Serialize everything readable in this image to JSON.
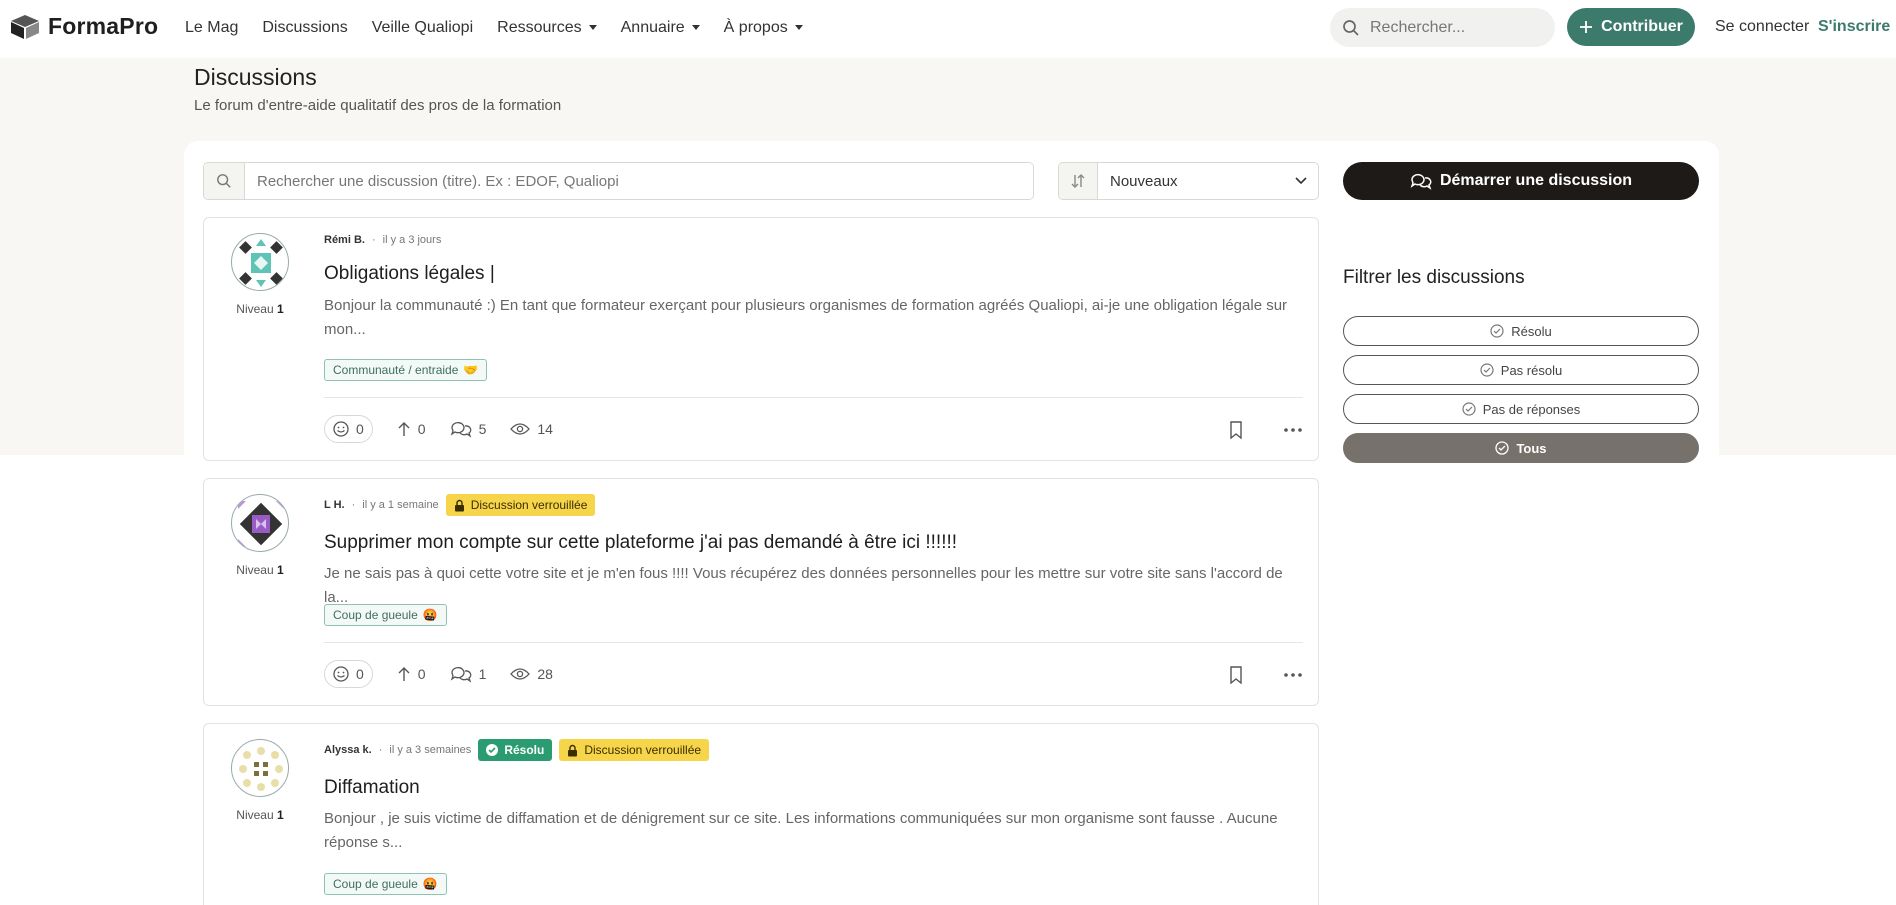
{
  "nav": {
    "brand": "FormaPro",
    "menu": [
      {
        "label": "Le Mag",
        "dropdown": false
      },
      {
        "label": "Discussions",
        "dropdown": false
      },
      {
        "label": "Veille Qualiopi",
        "dropdown": false
      },
      {
        "label": "Ressources",
        "dropdown": true
      },
      {
        "label": "Annuaire",
        "dropdown": true
      },
      {
        "label": "À propos",
        "dropdown": true
      }
    ],
    "search_placeholder": "Rechercher...",
    "contribute_label": "Contribuer",
    "login_label": "Se connecter",
    "signup_label": "S'inscrire"
  },
  "header": {
    "title": "Discussions",
    "subtitle": "Le forum d'entre-aide qualitatif des pros de la formation"
  },
  "toolbar": {
    "search_placeholder": "Rechercher une discussion (titre). Ex : EDOF, Qualiopi",
    "sort_value": "Nouveaux",
    "start_label": "Démarrer une discussion"
  },
  "filters": {
    "title": "Filtrer les discussions",
    "options": [
      {
        "label": "Résolu",
        "active": false
      },
      {
        "label": "Pas résolu",
        "active": false
      },
      {
        "label": "Pas de réponses",
        "active": false
      },
      {
        "label": "Tous",
        "active": true
      }
    ]
  },
  "discussions": [
    {
      "author": "Rémi B.",
      "time": "il y a 3 jours",
      "level_label": "Niveau",
      "level": "1",
      "badges": [],
      "title": "Obligations légales |",
      "excerpt": "Bonjour la communauté :) En tant que formateur exerçant pour plusieurs organismes de formation agréés Qualiopi, ai-je une obligation légale sur mon...",
      "tag": "Communauté / entraide",
      "tag_emoji": "🤝",
      "reactions": "0",
      "upvotes": "0",
      "comments": "5",
      "views": "14"
    },
    {
      "author": "L H.",
      "time": "il y a 1 semaine",
      "level_label": "Niveau",
      "level": "1",
      "badges": [
        "Discussion verrouillée"
      ],
      "title": "Supprimer mon compte sur cette plateforme j'ai pas demandé à être ici !!!!!!",
      "excerpt": "Je ne sais pas à quoi cette votre site et je m'en fous !!!! Vous récupérez des données personnelles pour les mettre sur votre site sans l'accord de la...",
      "tag": "Coup de gueule",
      "tag_emoji": "🤬",
      "reactions": "0",
      "upvotes": "0",
      "comments": "1",
      "views": "28"
    },
    {
      "author": "Alyssa k.",
      "time": "il y a 3 semaines",
      "level_label": "Niveau",
      "level": "1",
      "badge_resolved": "Résolu",
      "badges": [
        "Discussion verrouillée"
      ],
      "title": "Diffamation",
      "excerpt": "Bonjour , je suis victime de diffamation et de dénigrement sur ce site. Les informations communiquées sur mon organisme sont fausse . Aucune réponse s...",
      "tag": "Coup de gueule",
      "tag_emoji": "🤬"
    }
  ],
  "colors": {
    "accent": "#3c7b6c",
    "dark_button": "#1d1a18",
    "lock_badge": "#f7d54a",
    "resolved_badge": "#2b9c72",
    "active_filter": "#77716b",
    "hero_bg": "#f8f7f4"
  }
}
